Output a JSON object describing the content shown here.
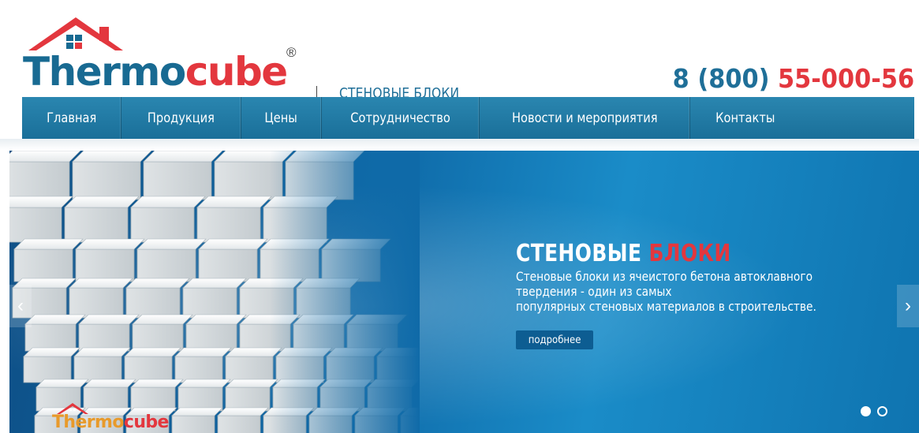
{
  "brand": {
    "logo_text_primary": "Thermo",
    "logo_text_accent": "cube",
    "registered_mark": "®",
    "tagline": "СТЕНОВЫЕ БЛОКИ",
    "phone_prefix": "8 (800)",
    "phone_number": "55-000-56"
  },
  "nav": {
    "items": [
      {
        "label": "Главная"
      },
      {
        "label": "Продукция"
      },
      {
        "label": "Цены"
      },
      {
        "label": "Сотрудничество"
      },
      {
        "label": "Новости и мероприятия"
      },
      {
        "label": "Контакты"
      }
    ]
  },
  "hero": {
    "title_main": "СТЕНОВЫЕ",
    "title_accent": "БЛОКИ",
    "description_lines": [
      "Стеновые блоки из ячеистого бетона автоклавного",
      "твердения - один из самых",
      "популярных стеновых материалов в строительстве."
    ],
    "more_label": "подробнее",
    "prev_icon": "‹",
    "next_icon": "›",
    "slide_count": 2,
    "active_slide": 1,
    "watermark_logo": "Thermocube"
  },
  "colors": {
    "brand_blue": "#186a92",
    "brand_red": "#e3373e",
    "nav_blue": "#1f7aa5"
  }
}
